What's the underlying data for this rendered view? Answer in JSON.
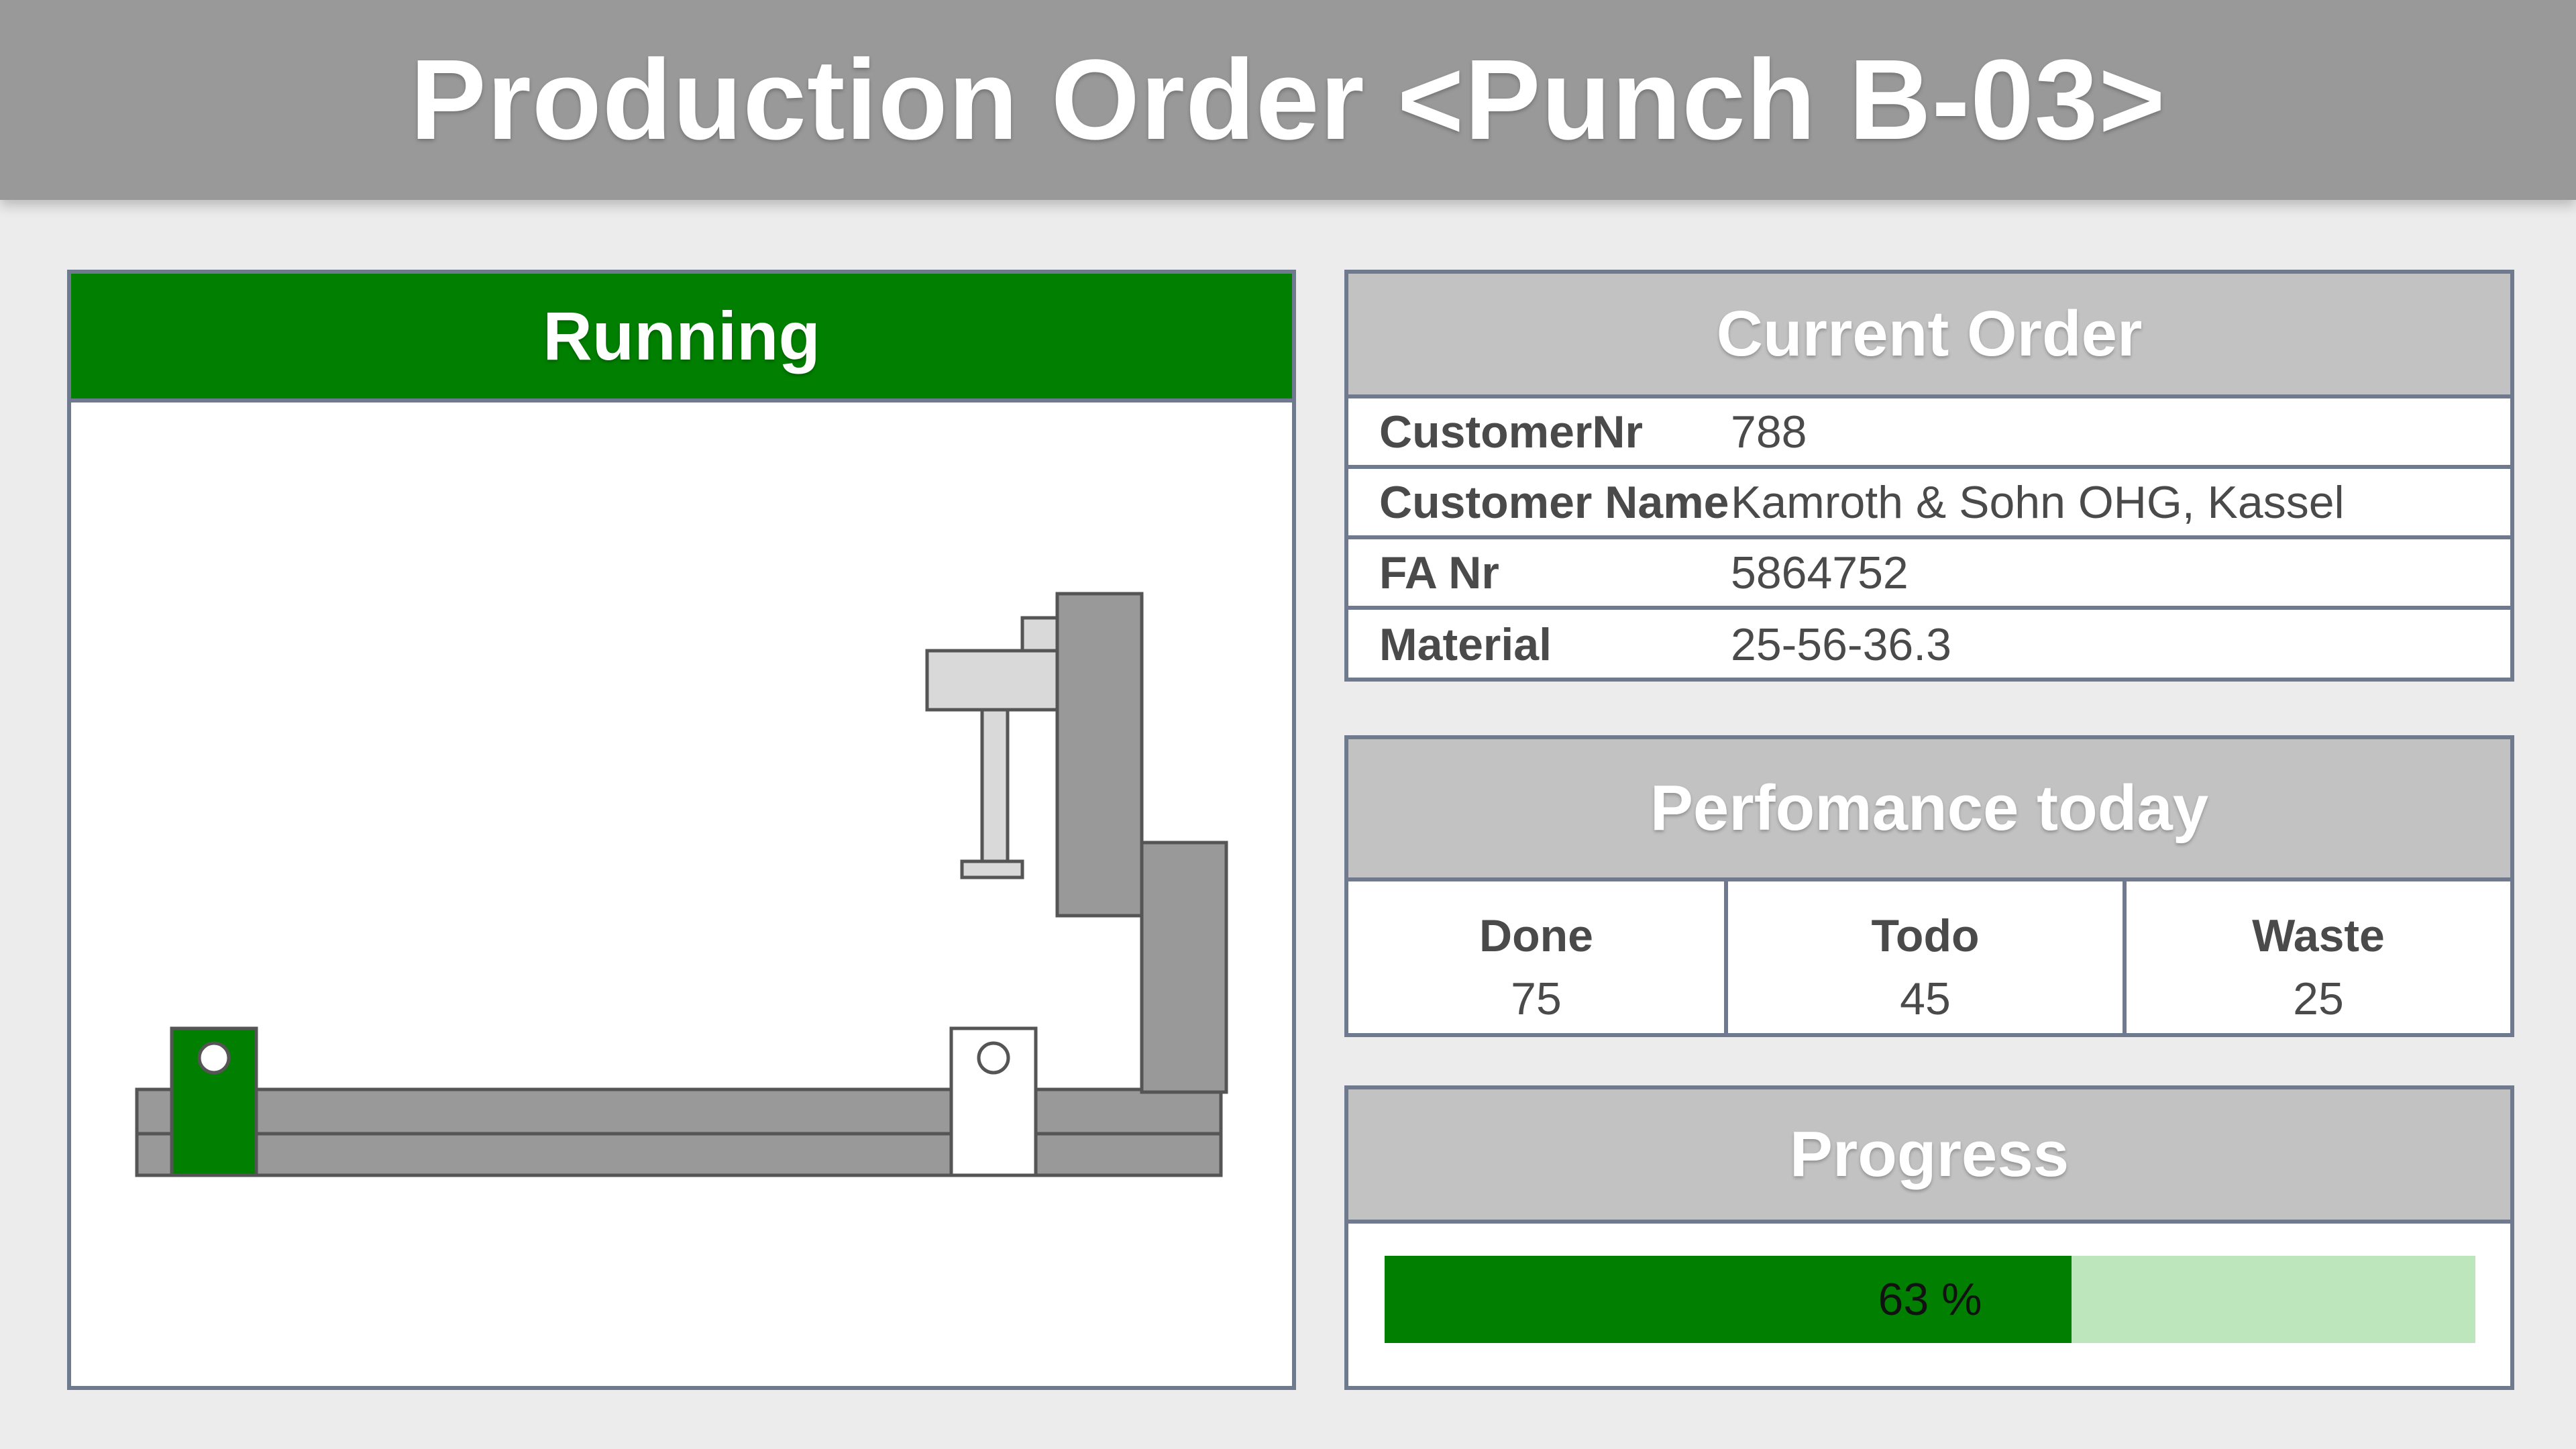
{
  "header": {
    "title": "Production Order <Punch B-03>"
  },
  "machine": {
    "status": "Running",
    "status_color": "#007f00"
  },
  "current_order": {
    "title": "Current Order",
    "rows": [
      {
        "label": "CustomerNr",
        "value": "788"
      },
      {
        "label": "Customer Name",
        "value": "Kamroth & Sohn OHG, Kassel"
      },
      {
        "label": "FA Nr",
        "value": "5864752"
      },
      {
        "label": "Material",
        "value": "25-56-36.3"
      }
    ]
  },
  "performance": {
    "title": "Perfomance today",
    "cells": [
      {
        "label": "Done",
        "value": "75"
      },
      {
        "label": "Todo",
        "value": "45"
      },
      {
        "label": "Waste",
        "value": "25"
      }
    ]
  },
  "progress": {
    "title": "Progress",
    "label": "63 %",
    "fraction": 0.63,
    "fill_color": "#007f00",
    "track_color": "#bde6bd"
  }
}
